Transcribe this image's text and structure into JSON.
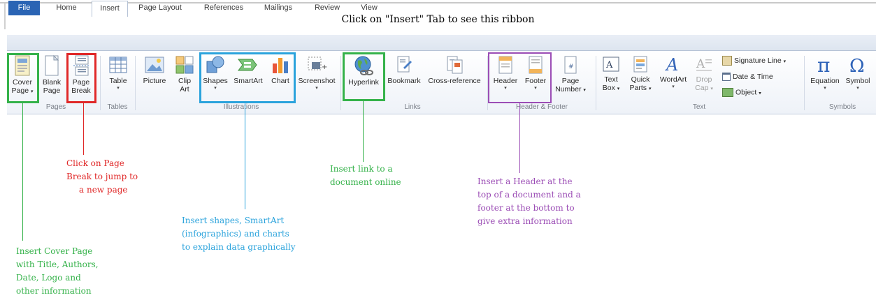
{
  "page_title": "Click on \"Insert\" Tab to see this ribbon",
  "tabs": [
    "File",
    "Home",
    "Insert",
    "Page Layout",
    "References",
    "Mailings",
    "Review",
    "View"
  ],
  "groups": {
    "pages": "Pages",
    "tables": "Tables",
    "illustrations": "Illustrations",
    "links": "Links",
    "header_footer": "Header & Footer",
    "text": "Text",
    "symbols": "Symbols"
  },
  "buttons": {
    "cover_page": [
      "Cover",
      "Page"
    ],
    "blank_page": [
      "Blank",
      "Page"
    ],
    "page_break": [
      "Page",
      "Break"
    ],
    "table": "Table",
    "picture": "Picture",
    "clip_art": [
      "Clip",
      "Art"
    ],
    "shapes": "Shapes",
    "smartart": "SmartArt",
    "chart": "Chart",
    "screenshot": "Screenshot",
    "hyperlink": "Hyperlink",
    "bookmark": "Bookmark",
    "cross_reference": "Cross-reference",
    "header": "Header",
    "footer": "Footer",
    "page_number": [
      "Page",
      "Number"
    ],
    "text_box": [
      "Text",
      "Box"
    ],
    "quick_parts": [
      "Quick",
      "Parts"
    ],
    "wordart": "WordArt",
    "drop_cap": [
      "Drop",
      "Cap"
    ],
    "signature_line": "Signature Line",
    "date_time": "Date & Time",
    "object": "Object",
    "equation": "Equation",
    "symbol": "Symbol"
  },
  "annotations": {
    "page_break": [
      "Click on Page",
      "Break to jump to",
      "a new page"
    ],
    "illustrations": [
      "Insert shapes, SmartArt",
      "(infographics) and charts",
      "to explain data graphically"
    ],
    "hyperlink": [
      "Insert link to a",
      "document online"
    ],
    "header_footer": [
      "Insert a Header at the",
      "top of a document and a",
      "footer at the bottom to",
      "give extra information"
    ],
    "cover_page": [
      "Insert Cover Page",
      "with Title, Authors,",
      "Date, Logo and",
      "other information"
    ]
  },
  "colors": {
    "green": "#35b24a",
    "red": "#e02828",
    "blue": "#2ba3dc",
    "purple": "#9b4db5",
    "file_tab": "#2a64b4"
  }
}
